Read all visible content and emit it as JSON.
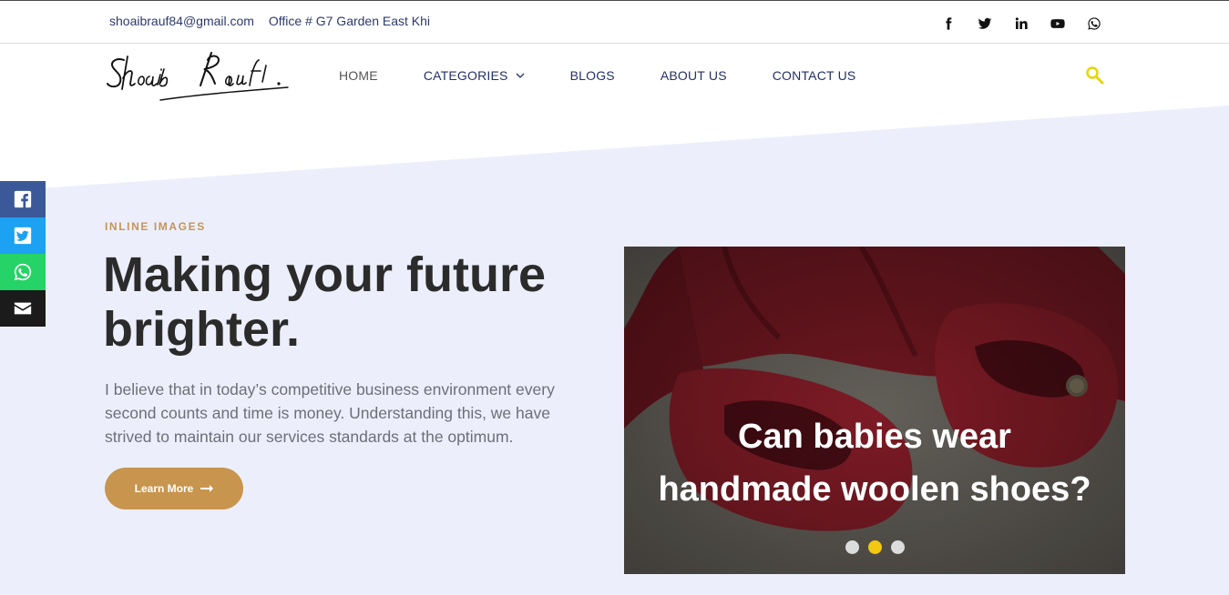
{
  "topbar": {
    "email": "shoaibrauf84@gmail.com",
    "office": "Office # G7 Garden East Khi",
    "social": [
      "facebook-icon",
      "twitter-icon",
      "linkedin-icon",
      "youtube-icon",
      "whatsapp-icon"
    ]
  },
  "logo": {
    "text": "Shoaib Rauf."
  },
  "nav": {
    "items": [
      {
        "label": "HOME"
      },
      {
        "label": "CATEGORIES"
      },
      {
        "label": "BLOGS"
      },
      {
        "label": "ABOUT US"
      },
      {
        "label": "CONTACT US"
      }
    ]
  },
  "side_share": [
    "facebook-icon",
    "twitter-icon",
    "whatsapp-icon",
    "email-icon"
  ],
  "hero": {
    "eyebrow": "INLINE IMAGES",
    "headline": "Making your future brighter.",
    "lead": "I believe that in today’s competitive business environment every second counts and time is money. Understanding this, we have strived to maintain our services standards at the optimum.",
    "button": "Learn More"
  },
  "slider": {
    "title_line1": "Can babies wear",
    "title_line2": "handmade woolen shoes?",
    "dots": 3,
    "active_dot": 2
  },
  "colors": {
    "accent": "#c8954e",
    "nav_text": "#253066",
    "hero_bg": "#eceffb",
    "search_icon": "#e3d60a",
    "active_dot": "#f2c811"
  }
}
